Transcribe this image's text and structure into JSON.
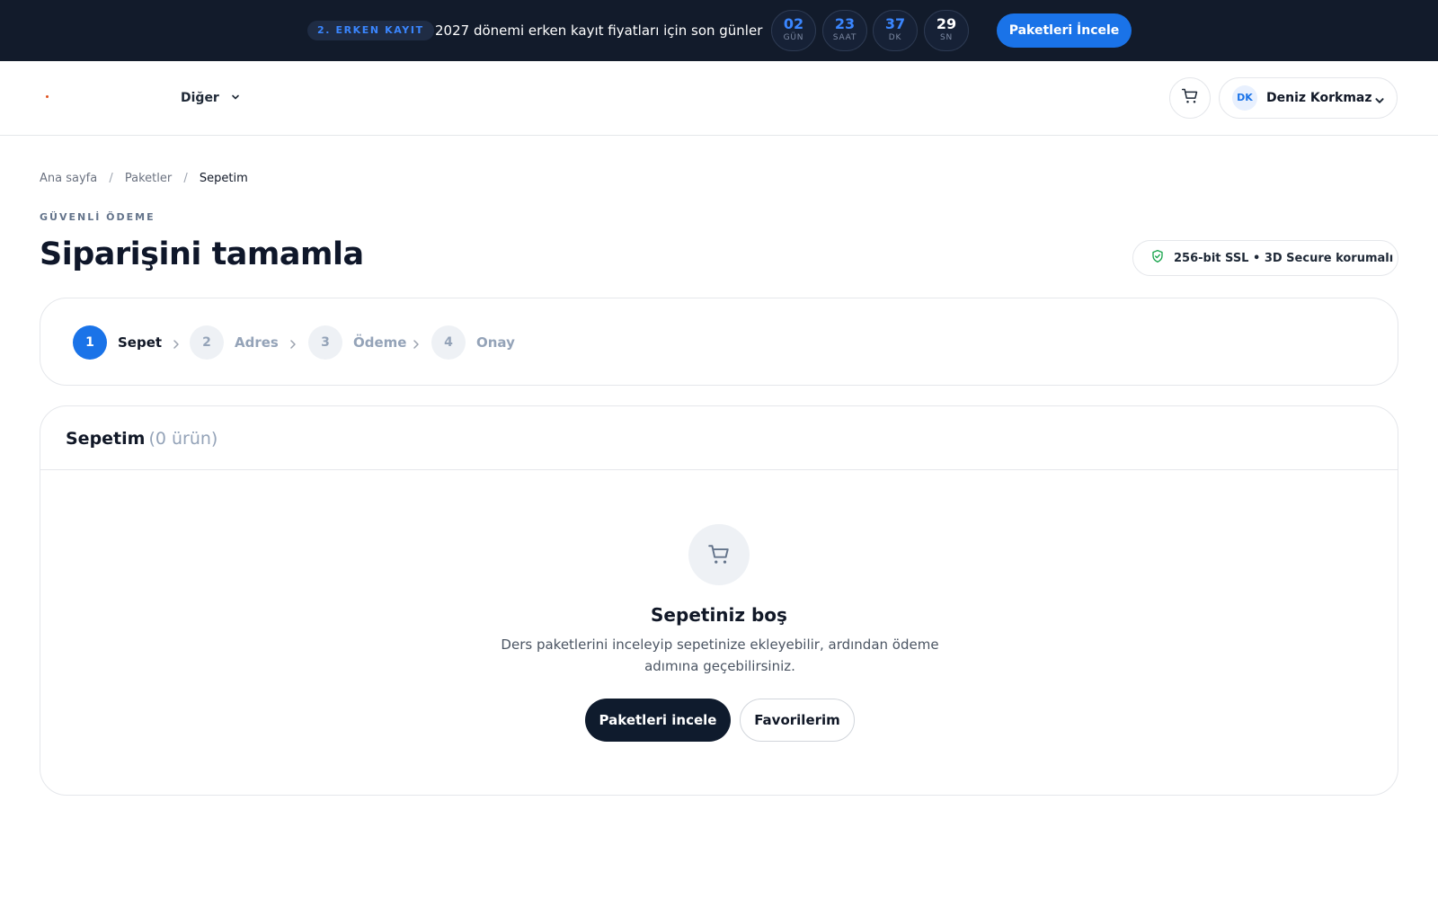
{
  "promo": {
    "badge": "2. ERKEN KAYIT",
    "text": "2027 dönemi erken kayıt fiyatları için son günler",
    "countdown": [
      {
        "value": "02",
        "unit": "GÜN"
      },
      {
        "value": "23",
        "unit": "SAAT"
      },
      {
        "value": "37",
        "unit": "DK"
      },
      {
        "value": "29",
        "unit": "SN"
      }
    ],
    "cta": "Paketleri İncele"
  },
  "header": {
    "nav_more": "Diğer",
    "user": {
      "initials": "DK",
      "name": "Deniz Korkmaz"
    }
  },
  "breadcrumb": [
    "Ana sayfa",
    "Paketler",
    "Sepetim"
  ],
  "page": {
    "eyebrow": "GÜVENLİ ÖDEME",
    "title": "Siparişini tamamla",
    "security_badge": "256-bit SSL • 3D Secure korumalı"
  },
  "steps": [
    {
      "number": "1",
      "label": "Sepet",
      "active": true
    },
    {
      "number": "2",
      "label": "Adres",
      "active": false
    },
    {
      "number": "3",
      "label": "Ödeme",
      "active": false
    },
    {
      "number": "4",
      "label": "Onay",
      "active": false
    }
  ],
  "cart": {
    "title": "Sepetim",
    "count": "(0 ürün)",
    "empty_title": "Sepetiniz boş",
    "empty_desc": "Ders paketlerini inceleyip sepetinize ekleyebilir, ardından ödeme adımına geçebilirsiniz.",
    "primary_button": "Paketleri incele",
    "secondary_button": "Favorilerim"
  },
  "colors": {
    "accent": "#1a73e8",
    "promo_bg": "#121b2b",
    "dark_button": "#0f1b2d",
    "logo_accent": "#e0531f"
  }
}
